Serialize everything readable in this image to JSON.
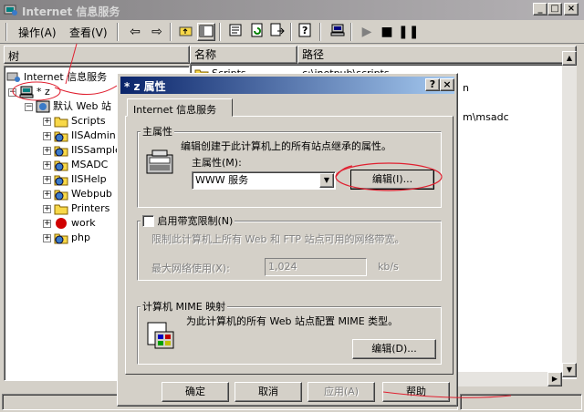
{
  "window": {
    "title": "Internet 信息服务",
    "min_label": "_",
    "max_label": "□",
    "close_label": "×"
  },
  "menu": {
    "action": "操作(A)",
    "view": "查看(V)"
  },
  "tree": {
    "header": "树",
    "root": "Internet 信息服务",
    "computer": "* z",
    "site": "默认 Web 站",
    "children": [
      "Scripts",
      "IISAdmin",
      "IISSample",
      "MSADC",
      "IISHelp",
      "Webpub",
      "Printers",
      "work",
      "php"
    ]
  },
  "list": {
    "col_name": "名称",
    "col_path": "路径",
    "rows": [
      {
        "name": "Scripts",
        "path": "c:\\inetpub\\scripts"
      },
      {
        "name": "",
        "path": "n"
      },
      {
        "name": "",
        "path": "m\\msadc"
      }
    ]
  },
  "dialog": {
    "title": "* z 属性",
    "help_label": "?",
    "close_label": "×",
    "tab": "Internet 信息服务",
    "master": {
      "group_title": "主属性",
      "description": "编辑创建于此计算机上的所有站点继承的属性。",
      "label": "主属性(M):",
      "select_value": "WWW 服务",
      "edit_button": "编辑(I)..."
    },
    "bandwidth": {
      "checkbox_label": "启用带宽限制(N)",
      "description": "限制此计算机上所有 Web 和 FTP 站点可用的网络带宽。",
      "max_label": "最大网络使用(X):",
      "max_value": "1,024",
      "unit": "kb/s"
    },
    "mime": {
      "group_title": "计算机 MIME 映射",
      "description": "为此计算机的所有 Web 站点配置 MIME 类型。",
      "edit_button": "编辑(D)..."
    },
    "buttons": {
      "ok": "确定",
      "cancel": "取消",
      "apply": "应用(A)",
      "help": "帮助"
    }
  },
  "colors": {
    "active_title": "#0a246a",
    "inactive_title": "#848284",
    "annotation": "#e02030",
    "face": "#d4d0c8"
  }
}
